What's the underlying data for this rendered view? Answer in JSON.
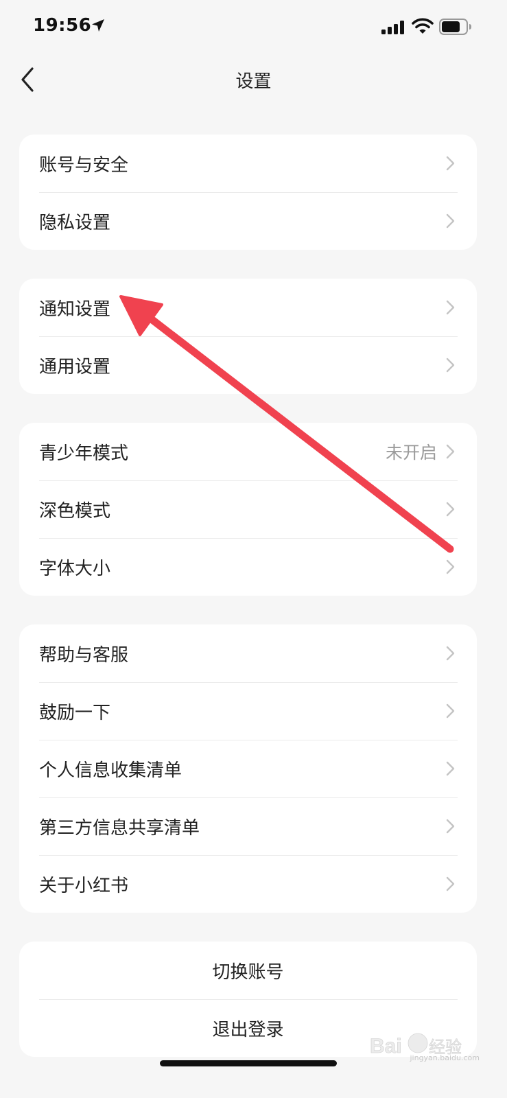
{
  "status_bar": {
    "time": "19:56"
  },
  "nav": {
    "title": "设置"
  },
  "groups": [
    {
      "items": [
        {
          "label": "账号与安全"
        },
        {
          "label": "隐私设置"
        }
      ]
    },
    {
      "items": [
        {
          "label": "通知设置"
        },
        {
          "label": "通用设置"
        }
      ]
    },
    {
      "items": [
        {
          "label": "青少年模式",
          "value": "未开启"
        },
        {
          "label": "深色模式"
        },
        {
          "label": "字体大小"
        }
      ]
    },
    {
      "items": [
        {
          "label": "帮助与客服"
        },
        {
          "label": "鼓励一下"
        },
        {
          "label": "个人信息收集清单"
        },
        {
          "label": "第三方信息共享清单"
        },
        {
          "label": "关于小红书"
        }
      ]
    }
  ],
  "account_actions": {
    "switch_account": "切换账号",
    "logout": "退出登录"
  },
  "watermark": {
    "logo_text": "Bai du 经验",
    "url_text": "jingyan.baidu.com"
  },
  "colors": {
    "annotation_arrow": "#f0424f",
    "background": "#f6f6f6",
    "card": "#ffffff"
  },
  "icons": [
    "location-arrow-icon",
    "signal-icon",
    "wifi-icon",
    "battery-icon",
    "back-icon",
    "chevron-right-icon"
  ]
}
